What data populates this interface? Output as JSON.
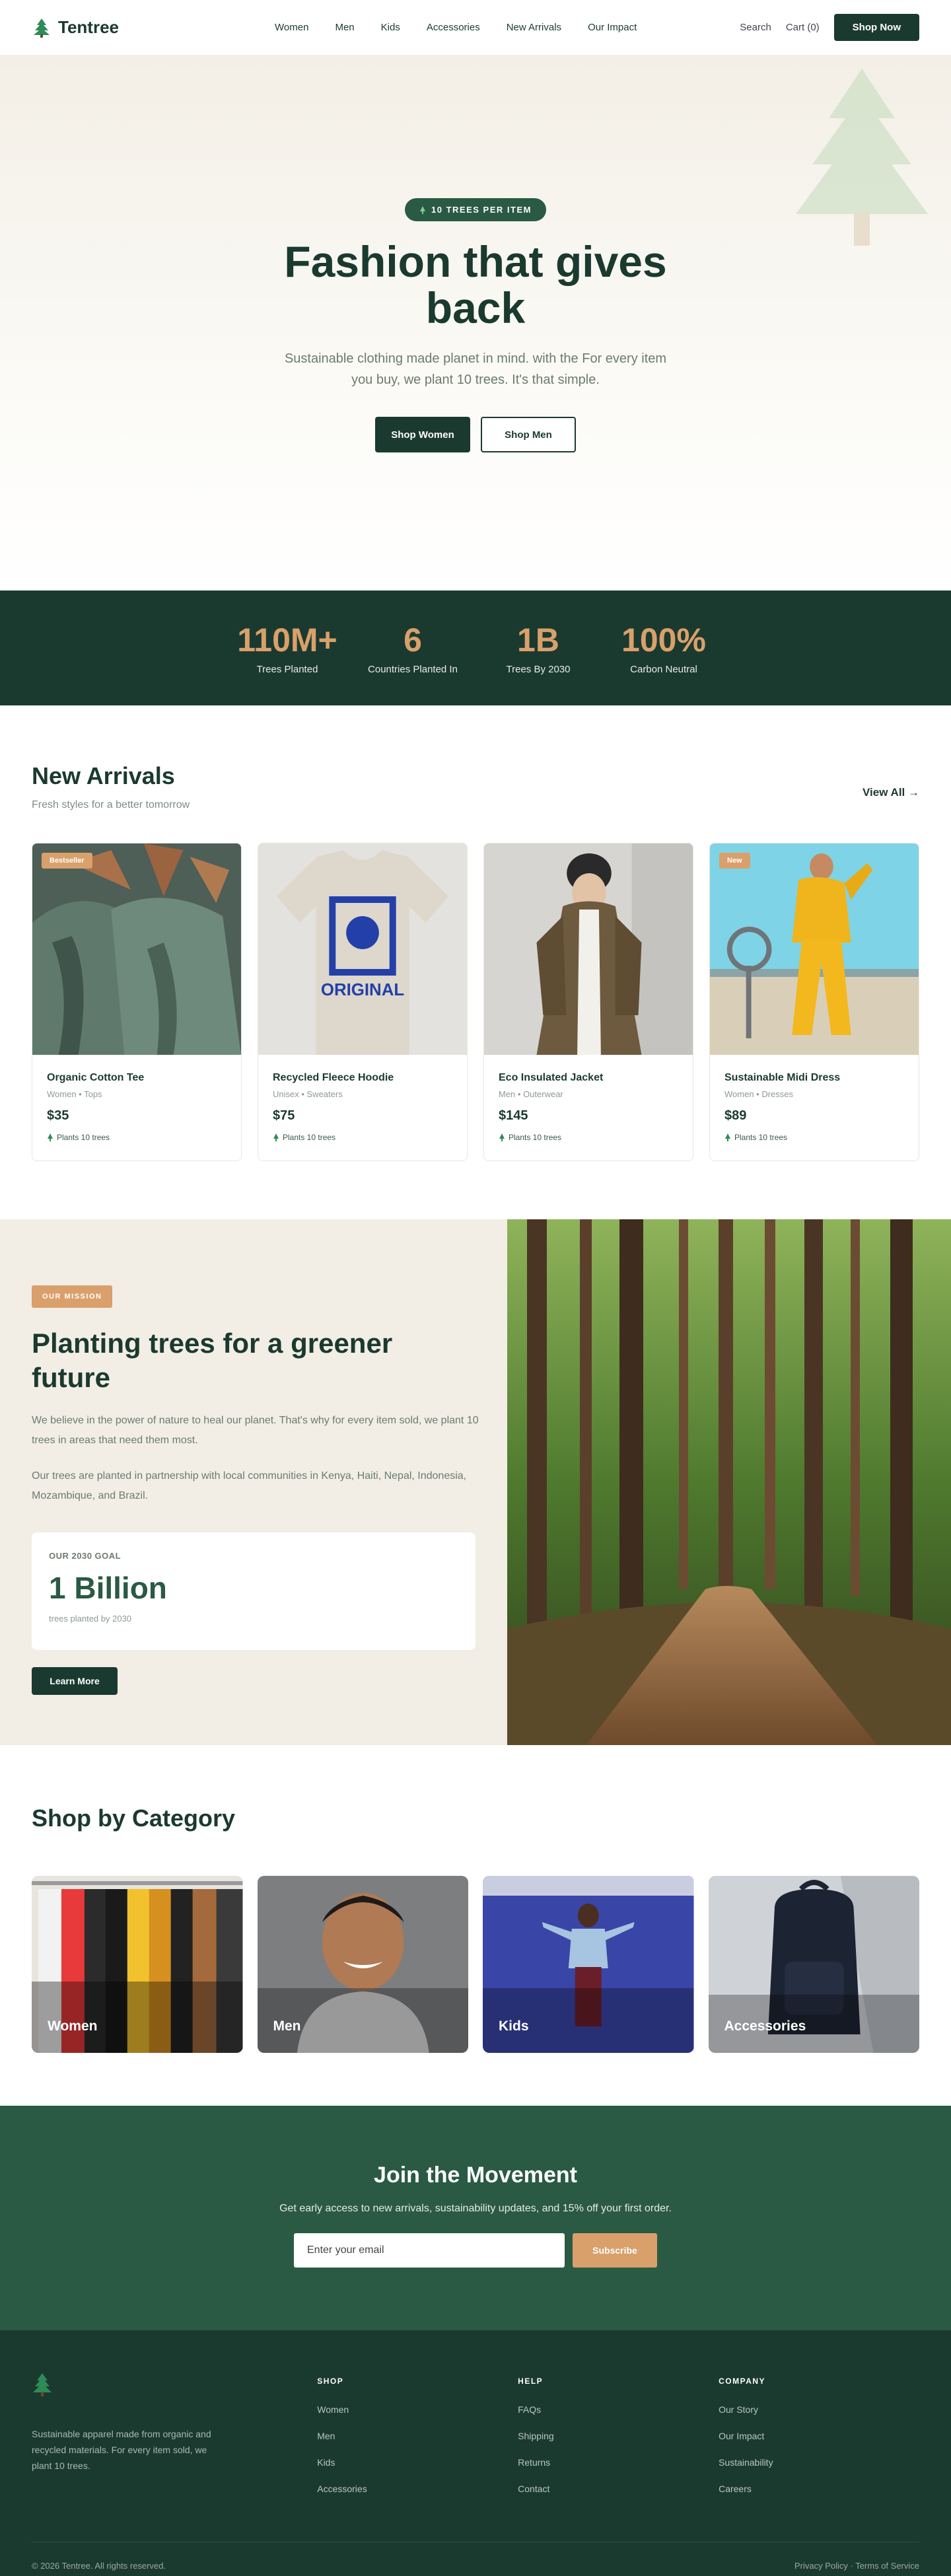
{
  "colors": {
    "forest": "#1b3a2f",
    "moss": "#2a5a44",
    "sand": "#d9a06b",
    "cream": "#f2eee5"
  },
  "nav": {
    "brand": "Tentree",
    "links": [
      "Women",
      "Men",
      "Kids",
      "Accessories",
      "New Arrivals",
      "Our Impact"
    ],
    "search": "Search",
    "cart": "Cart (0)",
    "cta": "Shop Now"
  },
  "hero": {
    "pill": "10 TREES PER ITEM",
    "title": "Fashion that gives back",
    "subtitle": "Sustainable clothing made planet in mind. with the For every item you buy, we plant 10 trees. It's that simple.",
    "btn_women": "Shop Women",
    "btn_men": "Shop Men"
  },
  "stats": [
    {
      "value": "110M+",
      "label": "Trees Planted"
    },
    {
      "value": "6",
      "label": "Countries Planted In"
    },
    {
      "value": "1B",
      "label": "Trees By 2030"
    },
    {
      "value": "100%",
      "label": "Carbon Neutral"
    }
  ],
  "arrivals": {
    "title": "New Arrivals",
    "subtitle": "Fresh styles for a better tomorrow",
    "view_all": "View All →",
    "products": [
      {
        "name": "Organic Cotton Tee",
        "category": "Women • Tops",
        "price": "$35",
        "trees": "Plants 10 trees",
        "badge": "Bestseller",
        "image_icon": "green-tees-on-hangers"
      },
      {
        "name": "Recycled Fleece Hoodie",
        "category": "Unisex • Sweaters",
        "price": "$75",
        "trees": "Plants 10 trees",
        "badge": "",
        "image_icon": "graphic-tshirt"
      },
      {
        "name": "Eco Insulated Jacket",
        "category": "Men • Outerwear",
        "price": "$145",
        "trees": "Plants 10 trees",
        "badge": "",
        "image_icon": "jacket-model"
      },
      {
        "name": "Sustainable Midi Dress",
        "category": "Women • Dresses",
        "price": "$89",
        "trees": "Plants 10 trees",
        "badge": "New",
        "image_icon": "yellow-tracksuit-model"
      }
    ],
    "tshirt_print": "ORIGINAL"
  },
  "mission": {
    "tag": "OUR MISSION",
    "title": "Planting trees for a greener future",
    "p1": "We believe in the power of nature to heal our planet. That's why for every item sold, we plant 10 trees in areas that need them most.",
    "p2": "Our trees are planted in partnership with local communities in Kenya, Haiti, Nepal, Indonesia, Mozambique, and Brazil.",
    "goal_label": "OUR 2030 GOAL",
    "goal_value": "1 Billion",
    "goal_sub": "trees planted by 2030",
    "button": "Learn More"
  },
  "categories": {
    "title": "Shop by Category",
    "items": [
      "Women",
      "Men",
      "Kids",
      "Accessories"
    ]
  },
  "newsletter": {
    "title": "Join the Movement",
    "subtitle": "Get early access to new arrivals, sustainability updates, and 15% off your first order.",
    "placeholder": "Enter your email",
    "button": "Subscribe"
  },
  "footer": {
    "about": "Sustainable apparel made from organic and recycled materials. For every item sold, we plant 10 trees.",
    "columns": [
      {
        "title": "SHOP",
        "links": [
          "Women",
          "Men",
          "Kids",
          "Accessories"
        ]
      },
      {
        "title": "HELP",
        "links": [
          "FAQs",
          "Shipping",
          "Returns",
          "Contact"
        ]
      },
      {
        "title": "COMPANY",
        "links": [
          "Our Story",
          "Our Impact",
          "Sustainability",
          "Careers"
        ]
      }
    ],
    "copyright": "© 2026 Tentree. All rights reserved.",
    "legal": "Privacy Policy · Terms of Service"
  }
}
